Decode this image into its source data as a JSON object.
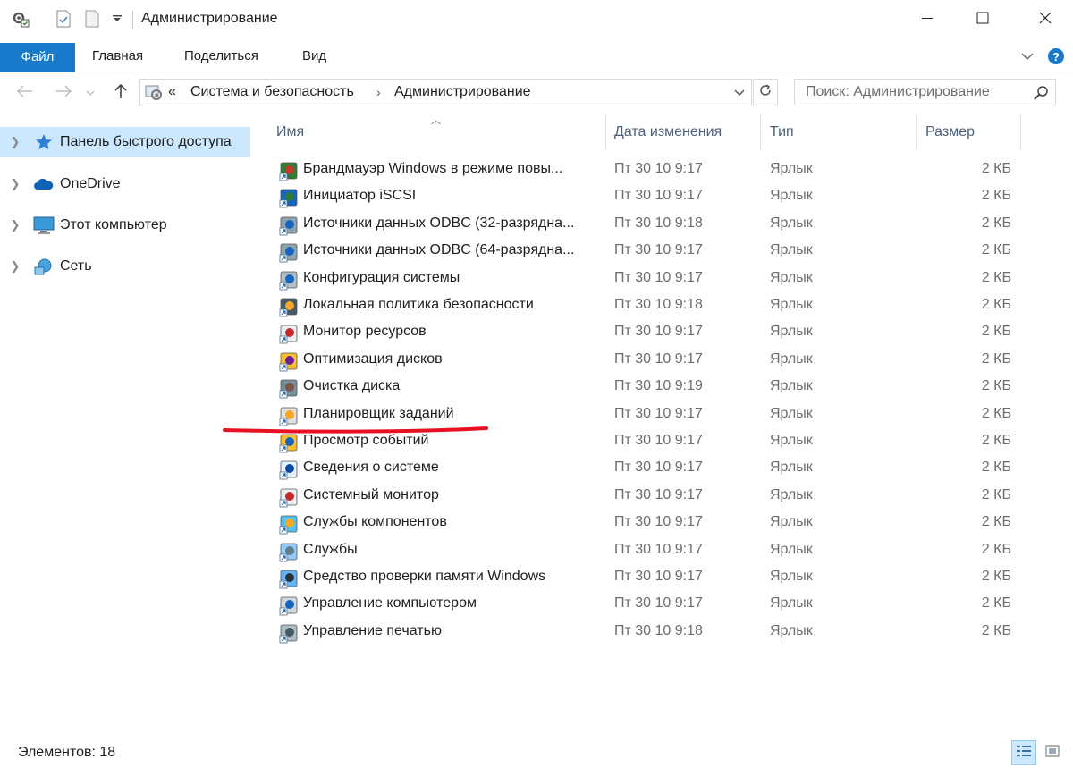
{
  "window": {
    "title": "Администрирование",
    "quick_access_icons": [
      "properties-icon",
      "new-document-icon",
      "new-folder-icon",
      "customize-dropdown-icon"
    ],
    "buttons": [
      "minimize-icon",
      "maximize-icon",
      "close-icon"
    ]
  },
  "ribbon": {
    "tabs": [
      "Файл",
      "Главная",
      "Поделиться",
      "Вид"
    ],
    "accent": "#1979ca"
  },
  "address": {
    "overflow": "«",
    "crumbs": [
      "Система и безопасность",
      "Администрирование"
    ]
  },
  "search": {
    "placeholder": "Поиск: Администрирование"
  },
  "navpane": {
    "items": [
      {
        "label": "Панель быстрого доступа",
        "icon": "star-icon",
        "selected": true
      },
      {
        "label": "OneDrive",
        "icon": "cloud-icon",
        "selected": false
      },
      {
        "label": "Этот компьютер",
        "icon": "computer-icon",
        "selected": false
      },
      {
        "label": "Сеть",
        "icon": "network-icon",
        "selected": false
      }
    ],
    "selected_color": "#cce8ff"
  },
  "list": {
    "columns": [
      "Имя",
      "Дата изменения",
      "Тип",
      "Размер"
    ],
    "rows": [
      {
        "name": "Брандмауэр Windows в режиме повы...",
        "date": "Пт 30 10 9:17",
        "type": "Ярлык",
        "size": "2 КБ",
        "icon": "firewall-icon"
      },
      {
        "name": "Инициатор iSCSI",
        "date": "Пт 30 10 9:17",
        "type": "Ярлык",
        "size": "2 КБ",
        "icon": "iscsi-icon"
      },
      {
        "name": "Источники данных ODBC (32-разрядна...",
        "date": "Пт 30 10 9:18",
        "type": "Ярлык",
        "size": "2 КБ",
        "icon": "odbc-icon"
      },
      {
        "name": "Источники данных ODBC (64-разрядна...",
        "date": "Пт 30 10 9:17",
        "type": "Ярлык",
        "size": "2 КБ",
        "icon": "odbc-icon"
      },
      {
        "name": "Конфигурация системы",
        "date": "Пт 30 10 9:17",
        "type": "Ярлык",
        "size": "2 КБ",
        "icon": "msconfig-icon"
      },
      {
        "name": "Локальная политика безопасности",
        "date": "Пт 30 10 9:18",
        "type": "Ярлык",
        "size": "2 КБ",
        "icon": "security-policy-icon"
      },
      {
        "name": "Монитор ресурсов",
        "date": "Пт 30 10 9:17",
        "type": "Ярлык",
        "size": "2 КБ",
        "icon": "resource-monitor-icon"
      },
      {
        "name": "Оптимизация дисков",
        "date": "Пт 30 10 9:17",
        "type": "Ярлык",
        "size": "2 КБ",
        "icon": "defrag-icon"
      },
      {
        "name": "Очистка диска",
        "date": "Пт 30 10 9:19",
        "type": "Ярлык",
        "size": "2 КБ",
        "icon": "disk-cleanup-icon"
      },
      {
        "name": "Планировщик заданий",
        "date": "Пт 30 10 9:17",
        "type": "Ярлык",
        "size": "2 КБ",
        "icon": "task-scheduler-icon"
      },
      {
        "name": "Просмотр событий",
        "date": "Пт 30 10 9:17",
        "type": "Ярлык",
        "size": "2 КБ",
        "icon": "event-viewer-icon"
      },
      {
        "name": "Сведения о системе",
        "date": "Пт 30 10 9:17",
        "type": "Ярлык",
        "size": "2 КБ",
        "icon": "system-info-icon"
      },
      {
        "name": "Системный монитор",
        "date": "Пт 30 10 9:17",
        "type": "Ярлык",
        "size": "2 КБ",
        "icon": "performance-monitor-icon"
      },
      {
        "name": "Службы компонентов",
        "date": "Пт 30 10 9:17",
        "type": "Ярлык",
        "size": "2 КБ",
        "icon": "component-services-icon"
      },
      {
        "name": "Службы",
        "date": "Пт 30 10 9:17",
        "type": "Ярлык",
        "size": "2 КБ",
        "icon": "services-icon"
      },
      {
        "name": "Средство проверки памяти Windows",
        "date": "Пт 30 10 9:17",
        "type": "Ярлык",
        "size": "2 КБ",
        "icon": "memory-diagnostic-icon"
      },
      {
        "name": "Управление компьютером",
        "date": "Пт 30 10 9:17",
        "type": "Ярлык",
        "size": "2 КБ",
        "icon": "computer-management-icon"
      },
      {
        "name": "Управление печатью",
        "date": "Пт 30 10 9:18",
        "type": "Ярлык",
        "size": "2 КБ",
        "icon": "print-management-icon"
      }
    ],
    "highlight_color": "#e81123"
  },
  "status": {
    "text": "Элементов: 18",
    "view_icons": [
      "details-view-icon",
      "large-icons-view-icon"
    ]
  }
}
